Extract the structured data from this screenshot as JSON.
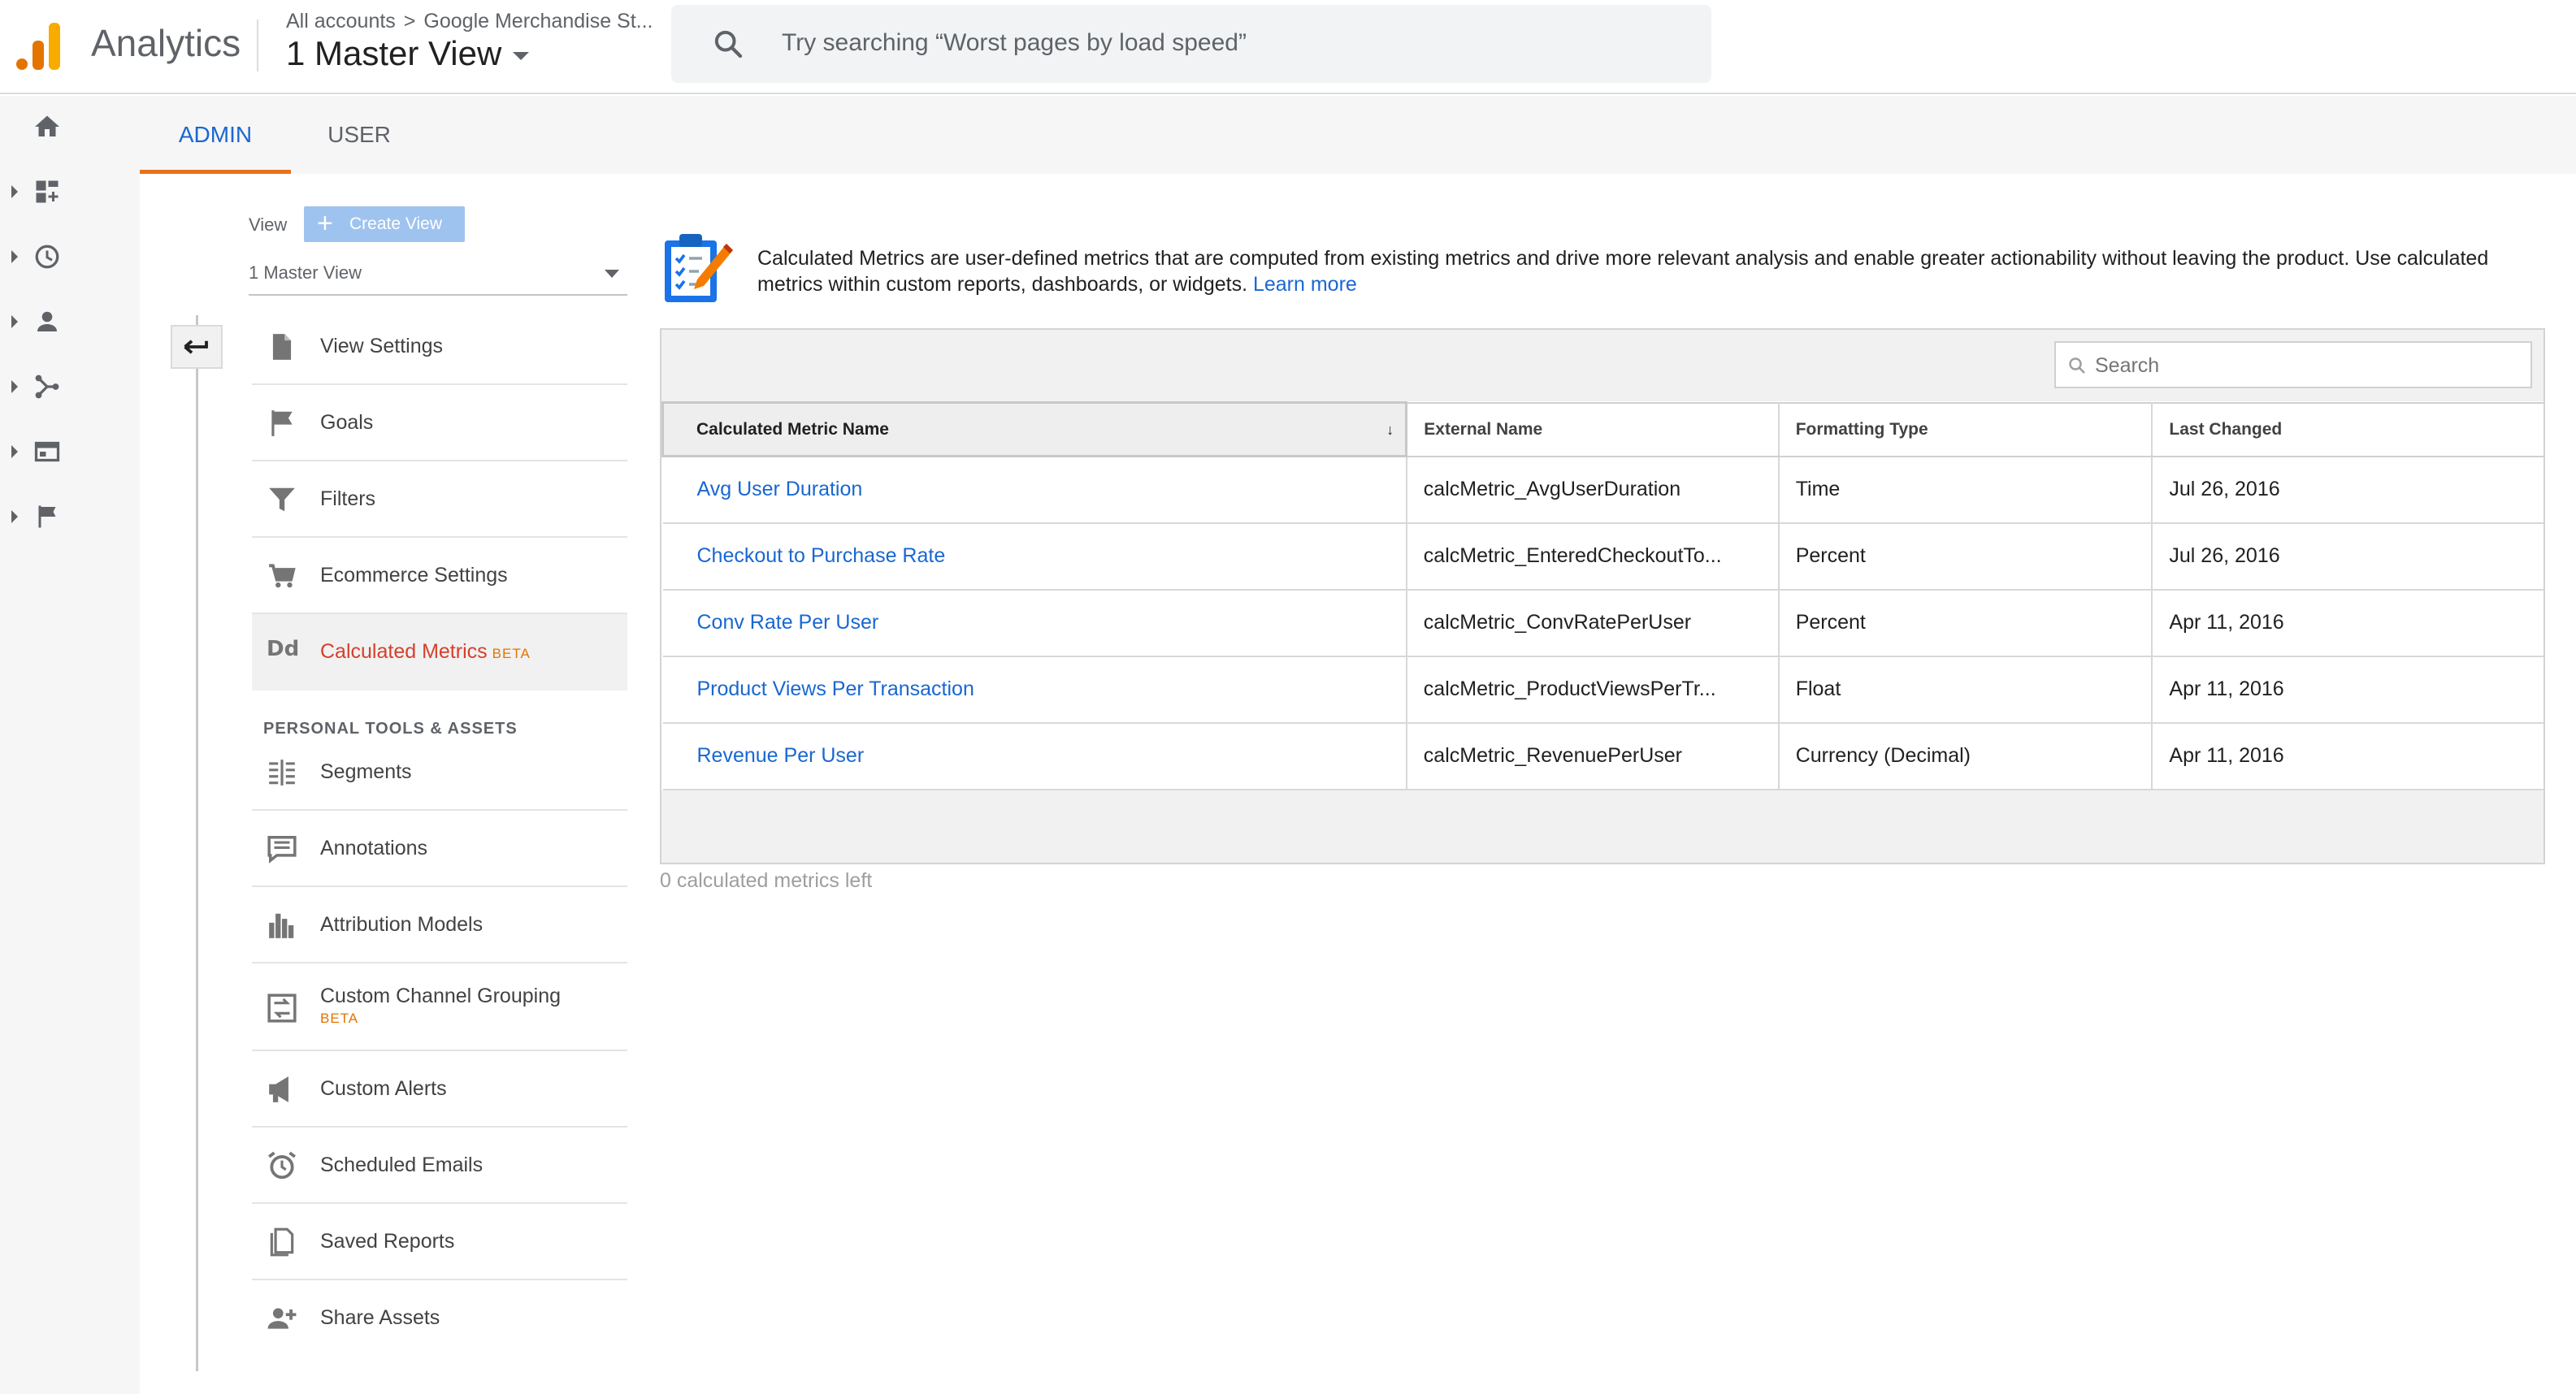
{
  "header": {
    "app_title": "Analytics",
    "breadcrumb": {
      "root": "All accounts",
      "separator": ">",
      "account": "Google Merchandise St..."
    },
    "view_name": "1 Master View",
    "search_placeholder": "Try searching “Worst pages by load speed”"
  },
  "rail": {
    "items": [
      "home-icon",
      "dashboard-icon",
      "clock-icon",
      "person-icon",
      "acquisition-icon",
      "behavior-icon",
      "conversions-flag-icon"
    ]
  },
  "tabs": {
    "admin": "ADMIN",
    "user": "USER"
  },
  "view_panel": {
    "label": "View",
    "create_button": "Create View",
    "selected_view": "1 Master View"
  },
  "menu": {
    "items": [
      {
        "label": "View Settings",
        "icon": "document-icon"
      },
      {
        "label": "Goals",
        "icon": "flag-icon"
      },
      {
        "label": "Filters",
        "icon": "filter-icon"
      },
      {
        "label": "Ecommerce Settings",
        "icon": "cart-icon"
      },
      {
        "label": "Calculated Metrics",
        "icon": "dd-icon",
        "badge": "BETA",
        "active": true
      }
    ],
    "section_title": "PERSONAL TOOLS & ASSETS",
    "tools": [
      {
        "label": "Segments",
        "icon": "segments-icon"
      },
      {
        "label": "Annotations",
        "icon": "annotation-icon"
      },
      {
        "label": "Attribution Models",
        "icon": "bar-chart-icon"
      },
      {
        "label": "Custom Channel Grouping",
        "icon": "channel-grouping-icon",
        "badge": "BETA"
      },
      {
        "label": "Custom Alerts",
        "icon": "megaphone-icon"
      },
      {
        "label": "Scheduled Emails",
        "icon": "alarm-clock-icon"
      },
      {
        "label": "Saved Reports",
        "icon": "saved-reports-icon"
      },
      {
        "label": "Share Assets",
        "icon": "add-person-icon"
      }
    ]
  },
  "content": {
    "description": "Calculated Metrics are user-defined metrics that are computed from existing metrics and drive more relevant analysis and enable greater actionability without leaving the product. Use calculated metrics within custom reports, dashboards, or widgets.",
    "learn_more": "Learn more",
    "table_search_placeholder": "Search",
    "columns": [
      "Calculated Metric Name",
      "External Name",
      "Formatting Type",
      "Last Changed"
    ],
    "sort_indicator": "↓",
    "rows": [
      {
        "name": "Avg User Duration",
        "external": "calcMetric_AvgUserDuration",
        "format": "Time",
        "changed": "Jul 26, 2016"
      },
      {
        "name": "Checkout to Purchase Rate",
        "external": "calcMetric_EnteredCheckoutTo...",
        "format": "Percent",
        "changed": "Jul 26, 2016"
      },
      {
        "name": "Conv Rate Per User",
        "external": "calcMetric_ConvRatePerUser",
        "format": "Percent",
        "changed": "Apr 11, 2016"
      },
      {
        "name": "Product Views Per Transaction",
        "external": "calcMetric_ProductViewsPerTr...",
        "format": "Float",
        "changed": "Apr 11, 2016"
      },
      {
        "name": "Revenue Per User",
        "external": "calcMetric_RevenuePerUser",
        "format": "Currency (Decimal)",
        "changed": "Apr 11, 2016"
      }
    ],
    "footer_note": "0 calculated metrics left"
  }
}
